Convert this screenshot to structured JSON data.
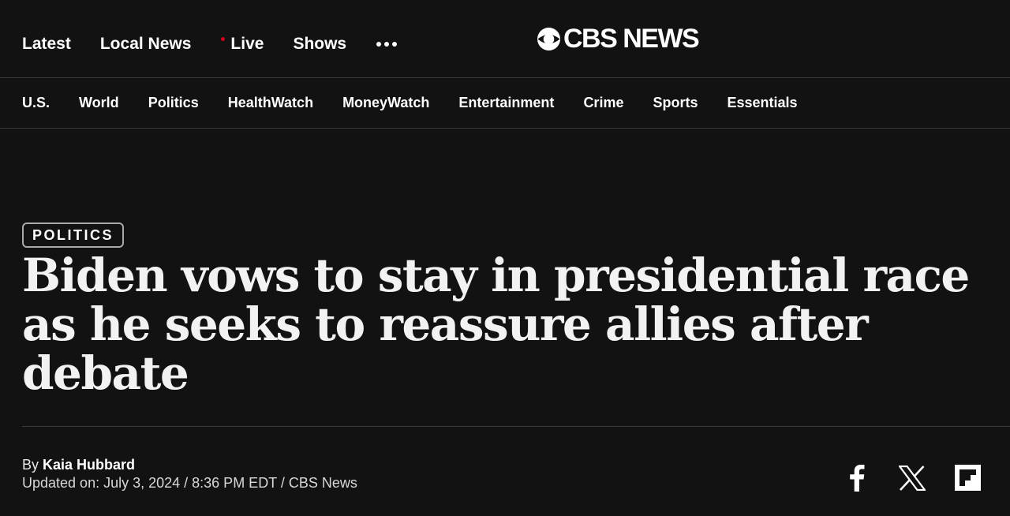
{
  "topnav": {
    "links": [
      "Latest",
      "Local News",
      "Live",
      "Shows"
    ],
    "more_icon": "more-dots-icon",
    "live_dot_color": "#d0021b"
  },
  "logo": {
    "text": "CBS NEWS",
    "icon": "cbs-eye-icon"
  },
  "sections": [
    "U.S.",
    "World",
    "Politics",
    "HealthWatch",
    "MoneyWatch",
    "Entertainment",
    "Crime",
    "Sports",
    "Essentials"
  ],
  "article": {
    "tag": "POLITICS",
    "headline": "Biden vows to stay in presidential race as he seeks to reassure allies after debate",
    "by_prefix": "By",
    "author": "Kaia Hubbard",
    "updated": "Updated on: July 3, 2024 / 8:36 PM EDT / CBS News"
  },
  "share": {
    "icons": [
      "facebook-icon",
      "x-icon",
      "flipboard-icon"
    ]
  },
  "colors": {
    "background": "#121212",
    "text": "#ffffff",
    "divider": "#3a3a3a"
  }
}
